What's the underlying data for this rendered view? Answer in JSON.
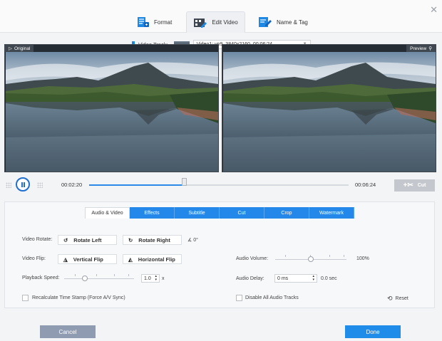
{
  "tabs": [
    {
      "label": "Format",
      "icon": "format-icon"
    },
    {
      "label": "Edit Video",
      "icon": "film-edit-icon",
      "active": true
    },
    {
      "label": "Name & Tag",
      "icon": "tag-edit-icon"
    }
  ],
  "video_track": {
    "label": "Video Track:",
    "value": "Video1: vp9, 3840x2160, 00:06:24"
  },
  "panes": {
    "original": "Original",
    "preview": "Preview"
  },
  "playback": {
    "current_time": "00:02:20",
    "total_time": "00:06:24",
    "progress": 0.365,
    "cut_label": "Cut"
  },
  "subtabs": [
    "Audio & Video",
    "Effects",
    "Subtitle",
    "Cut",
    "Crop",
    "Watermark"
  ],
  "settings": {
    "rotate_label": "Video Rotate:",
    "rotate_left": "Rotate Left",
    "rotate_right": "Rotate Right",
    "rotate_angle": "0°",
    "flip_label": "Video Flip:",
    "vertical_flip": "Vertical Flip",
    "horizontal_flip": "Horizontal Flip",
    "speed_label": "Playback Speed:",
    "speed_value": "1.0",
    "speed_unit": "x",
    "speed_level": 0.3,
    "recalc_label": "Recalculate Time Stamp (Force A/V Sync)",
    "volume_label": "Audio Volume:",
    "volume_value": "100%",
    "volume_level": 0.5,
    "delay_label": "Audio Delay:",
    "delay_value": "0 ms",
    "delay_sec": "0.0 sec",
    "disable_audio_label": "Disable All Audio Tracks",
    "reset_label": "Reset"
  },
  "buttons": {
    "cancel": "Cancel",
    "done": "Done"
  },
  "colors": {
    "accent": "#1e8ce8",
    "cancel": "#8e9bb1"
  }
}
